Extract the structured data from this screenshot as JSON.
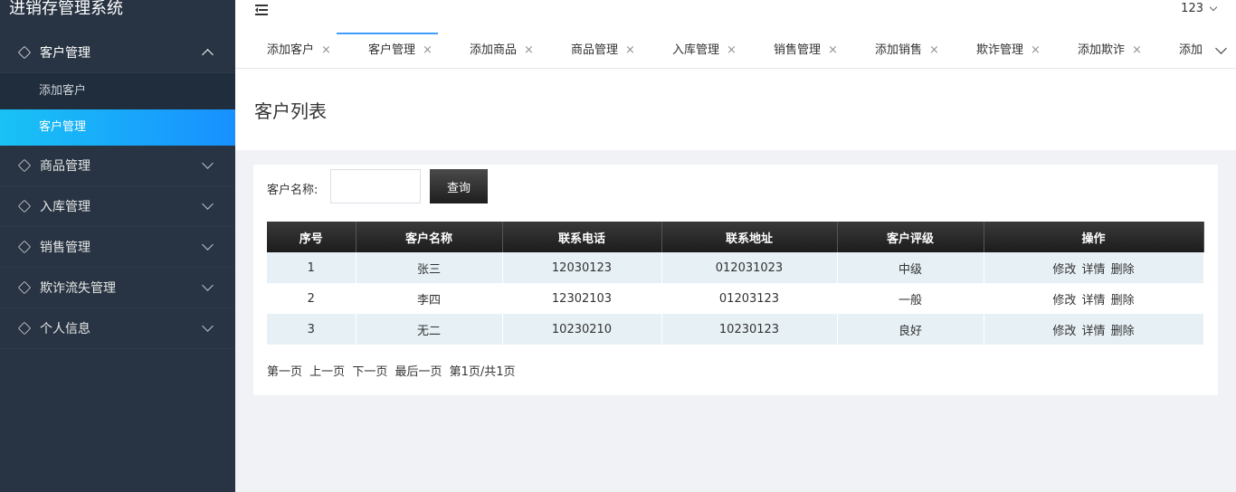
{
  "app": {
    "title": "进销存管理系统"
  },
  "user": {
    "name": "123"
  },
  "sidebar": {
    "groups": [
      {
        "label": "客户管理",
        "open": true,
        "items": [
          {
            "label": "添加客户",
            "active": false
          },
          {
            "label": "客户管理",
            "active": true
          }
        ]
      },
      {
        "label": "商品管理"
      },
      {
        "label": "入库管理"
      },
      {
        "label": "销售管理"
      },
      {
        "label": "欺诈流失管理"
      },
      {
        "label": "个人信息"
      }
    ]
  },
  "tabs": [
    {
      "label": "添加客户"
    },
    {
      "label": "客户管理",
      "active": true
    },
    {
      "label": "添加商品"
    },
    {
      "label": "商品管理"
    },
    {
      "label": "入库管理"
    },
    {
      "label": "销售管理"
    },
    {
      "label": "添加销售"
    },
    {
      "label": "欺诈管理"
    },
    {
      "label": "添加欺诈"
    },
    {
      "label": "添加"
    }
  ],
  "tab_close": "×",
  "page": {
    "title": "客户列表"
  },
  "search": {
    "label": "客户名称:",
    "value": "",
    "placeholder": "",
    "button": "查询"
  },
  "table": {
    "columns": [
      "序号",
      "客户名称",
      "联系电话",
      "联系地址",
      "客户评级",
      "操作"
    ],
    "rows": [
      {
        "id": "1",
        "name": "张三",
        "phone": "12030123",
        "address": "012031023",
        "rating": "中级"
      },
      {
        "id": "2",
        "name": "李四",
        "phone": "12302103",
        "address": "01203123",
        "rating": "一般"
      },
      {
        "id": "3",
        "name": "无二",
        "phone": "10230210",
        "address": "10230123",
        "rating": "良好"
      }
    ],
    "actions": {
      "edit": "修改",
      "detail": "详情",
      "delete": "删除"
    }
  },
  "pager": {
    "first": "第一页",
    "prev": "上一页",
    "next": "下一页",
    "last": "最后一页",
    "info": "第1页/共1页"
  }
}
